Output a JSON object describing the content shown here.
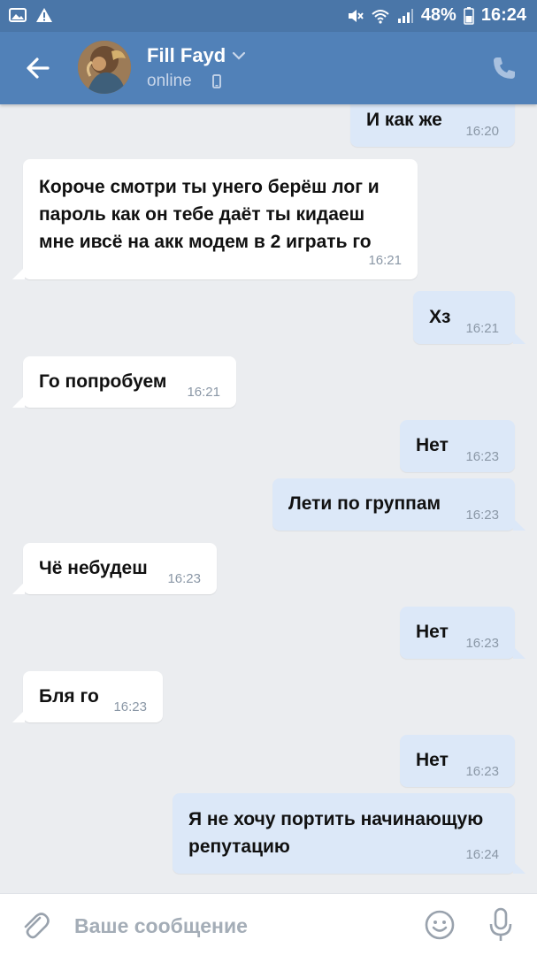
{
  "status_bar": {
    "battery": "48%",
    "time": "16:24",
    "icons": [
      "image-icon",
      "warning-icon",
      "mute-icon",
      "wifi-icon",
      "signal-icon",
      "battery-icon"
    ]
  },
  "header": {
    "contact_name": "Fill Fayd",
    "status": "online",
    "icons": [
      "back-arrow-icon",
      "chevron-down-icon",
      "mobile-phone-icon",
      "call-icon"
    ]
  },
  "messages": [
    {
      "dir": "out",
      "lines": [
        "И как же"
      ],
      "time": "16:20"
    },
    {
      "dir": "in",
      "lines": [
        "Короче смотри ты унего берёш лог и",
        "пароль как он тебе даёт ты кидаеш",
        "мне ивсё на акк модем в 2 играть го"
      ],
      "time": "16:21"
    },
    {
      "dir": "out",
      "lines": [
        "Хз"
      ],
      "time": "16:21"
    },
    {
      "dir": "in",
      "lines": [
        "Го попробуем"
      ],
      "time": "16:21"
    },
    {
      "dir": "out",
      "lines": [
        "Нет"
      ],
      "time": "16:23"
    },
    {
      "dir": "out",
      "lines": [
        "Лети по группам"
      ],
      "time": "16:23"
    },
    {
      "dir": "in",
      "lines": [
        "Чё небудеш"
      ],
      "time": "16:23"
    },
    {
      "dir": "out",
      "lines": [
        "Нет"
      ],
      "time": "16:23"
    },
    {
      "dir": "in",
      "lines": [
        "Бля го"
      ],
      "time": "16:23"
    },
    {
      "dir": "out",
      "lines": [
        "Нет"
      ],
      "time": "16:23"
    },
    {
      "dir": "out",
      "lines": [
        "Я не хочу портить начинающую",
        "репутацию"
      ],
      "time": "16:24"
    }
  ],
  "composer": {
    "placeholder": "Ваше сообщение",
    "icons": [
      "attach-icon",
      "emoji-icon",
      "microphone-icon"
    ]
  },
  "colors": {
    "header": "#5181b8",
    "status_bar": "#4a76a8",
    "background": "#ebedf0",
    "incoming_bubble": "#ffffff",
    "outgoing_bubble": "#dce8f8"
  }
}
